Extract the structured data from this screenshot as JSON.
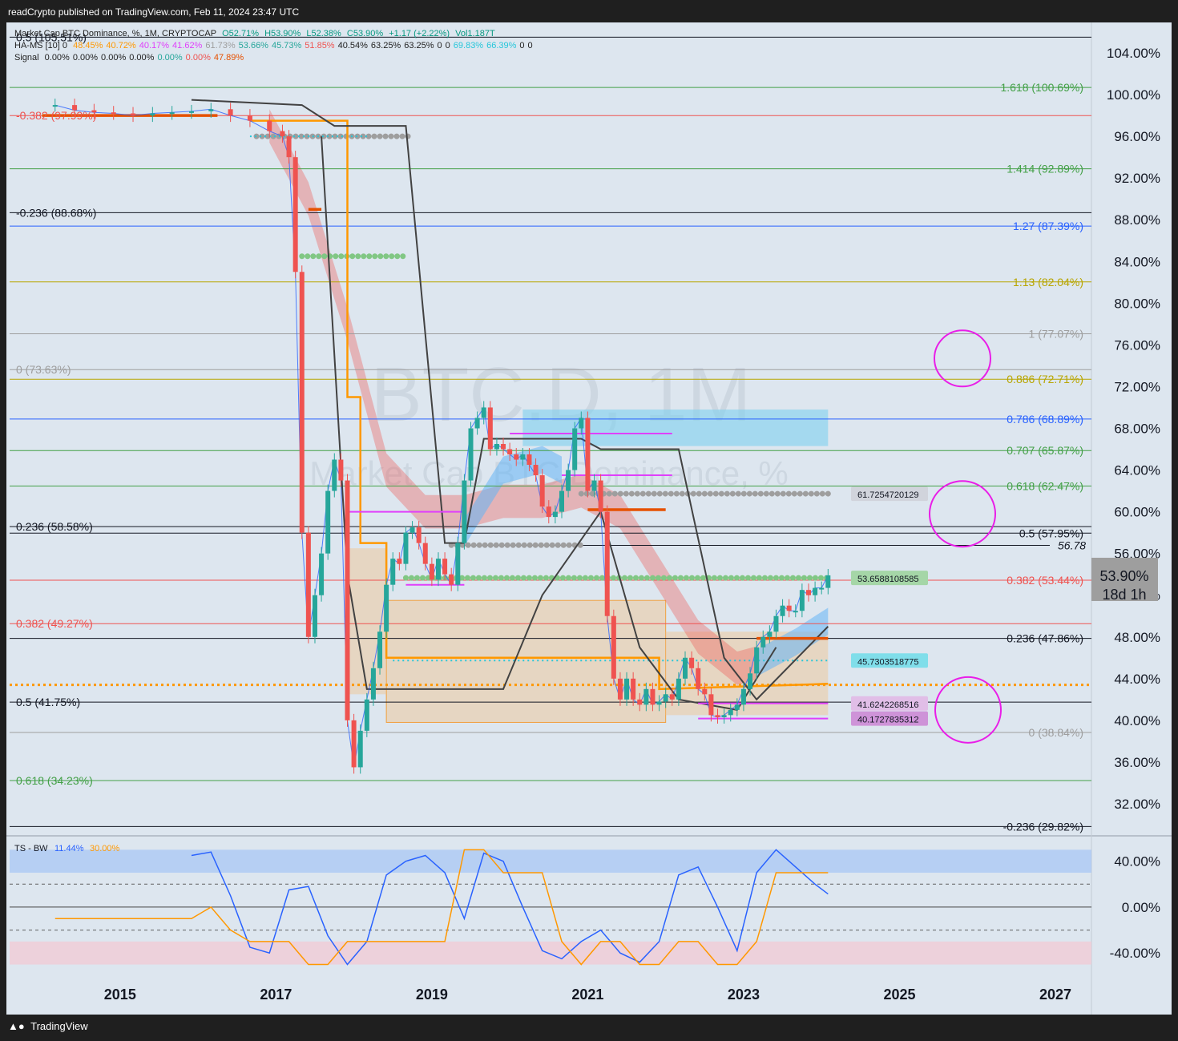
{
  "header": {
    "publisher": "readCrypto published on TradingView.com, Feb 11, 2024 23:47 UTC"
  },
  "footer": {
    "brand": "TradingView"
  },
  "legend": {
    "line1": {
      "name": "Market Cap BTC Dominance, %, 1M, CRYPTOCAP",
      "o": "O52.71%",
      "h": "H53.90%",
      "l": "L52.38%",
      "c": "C53.90%",
      "chg": "+1.17 (+2.22%)",
      "vol": "Vol1.187T"
    },
    "line2": {
      "name": "HA-MS [10] 0",
      "vals": [
        "48.45%",
        "40.72%",
        "40.17%",
        "41.62%",
        "61.73%",
        "53.66%",
        "45.73%",
        "51.85%",
        "40.54%",
        "63.25%",
        "63.25%",
        "0",
        "0",
        "69.83%",
        "66.39%",
        "0",
        "0"
      ]
    },
    "line3": {
      "name": "Signal",
      "vals": [
        "0.00%",
        "0.00%",
        "0.00%",
        "0.00%",
        "0.00%",
        "0.00%",
        "47.89%"
      ]
    }
  },
  "watermark": {
    "symbol": "BTC.D, 1M",
    "name": "Market Cap BTC Dominance, %"
  },
  "colors": {
    "up": "#26a69a",
    "down": "#ef5350",
    "fib_green": "#43a047",
    "fib_blue": "#2962ff",
    "fib_yellow": "#b8a500",
    "magenta": "#e040fb",
    "orange": "#ff9800"
  },
  "chart_data": [
    {
      "type": "candlestick",
      "title": "Market Cap BTC Dominance, %, 1M, CRYPTOCAP",
      "ylim": [
        29,
        106
      ],
      "y_ticks": [
        "104.00%",
        "100.00%",
        "96.00%",
        "92.00%",
        "88.00%",
        "84.00%",
        "80.00%",
        "76.00%",
        "72.00%",
        "68.00%",
        "64.00%",
        "60.00%",
        "56.00%",
        "52.00%",
        "48.00%",
        "44.00%",
        "40.00%",
        "36.00%",
        "32.00%"
      ],
      "x_ticks": [
        "2015",
        "2017",
        "2019",
        "2021",
        "2023",
        "2025",
        "2027"
      ],
      "price_label": {
        "value": "53.90%",
        "countdown": "18d 1h"
      },
      "close_series": {
        "dates": [
          "2014-03",
          "2014-06",
          "2014-09",
          "2014-12",
          "2015-03",
          "2015-06",
          "2015-09",
          "2015-12",
          "2016-03",
          "2016-06",
          "2016-09",
          "2016-12",
          "2017-02",
          "2017-03",
          "2017-04",
          "2017-05",
          "2017-06",
          "2017-07",
          "2017-08",
          "2017-09",
          "2017-10",
          "2017-11",
          "2017-12",
          "2018-01",
          "2018-02",
          "2018-03",
          "2018-04",
          "2018-05",
          "2018-06",
          "2018-07",
          "2018-08",
          "2018-09",
          "2018-10",
          "2018-11",
          "2018-12",
          "2019-01",
          "2019-02",
          "2019-03",
          "2019-04",
          "2019-05",
          "2019-06",
          "2019-07",
          "2019-08",
          "2019-09",
          "2019-10",
          "2019-11",
          "2019-12",
          "2020-01",
          "2020-02",
          "2020-03",
          "2020-04",
          "2020-05",
          "2020-06",
          "2020-07",
          "2020-08",
          "2020-09",
          "2020-10",
          "2020-11",
          "2020-12",
          "2021-01",
          "2021-02",
          "2021-03",
          "2021-04",
          "2021-05",
          "2021-06",
          "2021-07",
          "2021-08",
          "2021-09",
          "2021-10",
          "2021-11",
          "2021-12",
          "2022-01",
          "2022-02",
          "2022-03",
          "2022-04",
          "2022-05",
          "2022-06",
          "2022-07",
          "2022-08",
          "2022-09",
          "2022-10",
          "2022-11",
          "2022-12",
          "2023-01",
          "2023-02",
          "2023-03",
          "2023-04",
          "2023-05",
          "2023-06",
          "2023-07",
          "2023-08",
          "2023-09",
          "2023-10",
          "2023-11",
          "2023-12",
          "2024-01",
          "2024-02"
        ],
        "values": [
          99.0,
          98.5,
          98.3,
          98.2,
          98.0,
          98.2,
          98.3,
          98.4,
          98.6,
          98.0,
          97.5,
          96.5,
          96.0,
          94.0,
          83.0,
          58.0,
          48.0,
          52.0,
          56.0,
          62.0,
          65.0,
          63.0,
          40.0,
          35.5,
          39.0,
          42.0,
          45.0,
          48.5,
          53.0,
          55.5,
          55.0,
          58.0,
          58.5,
          57.0,
          55.0,
          53.5,
          55.5,
          54.0,
          53.0,
          57.0,
          63.0,
          68.0,
          69.0,
          70.0,
          66.0,
          66.5,
          66.0,
          65.5,
          65.0,
          65.5,
          64.5,
          63.5,
          60.5,
          59.5,
          60.0,
          62.0,
          64.0,
          68.0,
          69.0,
          62.0,
          63.0,
          60.0,
          50.0,
          44.0,
          42.0,
          44.0,
          42.0,
          41.5,
          43.0,
          41.5,
          41.8,
          42.5,
          42.0,
          44.0,
          46.0,
          45.0,
          43.0,
          42.5,
          40.5,
          40.3,
          40.5,
          41.0,
          41.5,
          43.0,
          44.5,
          47.0,
          48.0,
          48.5,
          50.0,
          51.0,
          50.5,
          50.5,
          52.5,
          52.0,
          52.7,
          52.7,
          53.9
        ]
      },
      "left_fib_levels": [
        {
          "label": "0.5 (105.51%)",
          "value": 105.51
        },
        {
          "label": "-0.382 (97.99%)",
          "value": 97.99
        },
        {
          "label": "-0.236 (88.68%)",
          "value": 88.68
        },
        {
          "label": "0 (73.63%)",
          "value": 73.63
        },
        {
          "label": "0.236 (58.58%)",
          "value": 58.58
        },
        {
          "label": "0.382 (49.27%)",
          "value": 49.27
        },
        {
          "label": "0.5 (41.75%)",
          "value": 41.75
        },
        {
          "label": "0.618 (34.23%)",
          "value": 34.23
        }
      ],
      "right_fib_levels": [
        {
          "label": "1.618 (100.69%)",
          "value": 100.69
        },
        {
          "label": "1.414 (92.89%)",
          "value": 92.89
        },
        {
          "label": "1.27 (87.39%)",
          "value": 87.39
        },
        {
          "label": "1.13 (82.04%)",
          "value": 82.04
        },
        {
          "label": "1 (77.07%)",
          "value": 77.07
        },
        {
          "label": "0.886 (72.71%)",
          "value": 72.71
        },
        {
          "label": "0.786 (68.89%)",
          "value": 68.89
        },
        {
          "label": "0.707 (65.87%)",
          "value": 65.87
        },
        {
          "label": "0.618 (62.47%)",
          "value": 62.47
        },
        {
          "label": "0.5 (57.95%)",
          "value": 57.95
        },
        {
          "label": "0.382 (53.44%)",
          "value": 53.44
        },
        {
          "label": "0.236 (47.86%)",
          "value": 47.86
        },
        {
          "label": "0 (38.84%)",
          "value": 38.84
        },
        {
          "label": "-0.236 (29.82%)",
          "value": 29.82
        }
      ],
      "level_tags": [
        {
          "label": "61.7254720129",
          "value": 61.73
        },
        {
          "label": "53.6588108585",
          "value": 53.66
        },
        {
          "label": "45.7303518775",
          "value": 45.73
        },
        {
          "label": "41.6242268516",
          "value": 41.62
        },
        {
          "label": "40.1727835312",
          "value": 40.17
        }
      ],
      "extra_labels": [
        {
          "label": "56.78",
          "value": 56.78
        }
      ],
      "highlight_circles_at": [
        74.7,
        59.8,
        41.0
      ]
    },
    {
      "type": "line",
      "title": "TS - BW",
      "legend": [
        {
          "name": "11.44%",
          "color": "#2962ff"
        },
        {
          "name": "30.00%",
          "color": "#ff9800"
        }
      ],
      "ylim": [
        -58,
        60
      ],
      "y_ticks": [
        "40.00%",
        "0.00%",
        "-40.00%"
      ],
      "series": [
        {
          "name": "11.44%",
          "dates": [
            "2015-12",
            "2016-03",
            "2016-06",
            "2016-09",
            "2016-12",
            "2017-03",
            "2017-06",
            "2017-09",
            "2017-12",
            "2018-03",
            "2018-06",
            "2018-09",
            "2018-12",
            "2019-03",
            "2019-06",
            "2019-09",
            "2019-12",
            "2020-03",
            "2020-06",
            "2020-09",
            "2020-12",
            "2021-03",
            "2021-06",
            "2021-09",
            "2021-12",
            "2022-03",
            "2022-06",
            "2022-09",
            "2022-12",
            "2023-03",
            "2023-06",
            "2023-09",
            "2023-12",
            "2024-02"
          ],
          "values": [
            45,
            48,
            10,
            -35,
            -40,
            15,
            18,
            -25,
            -50,
            -30,
            28,
            40,
            45,
            30,
            -10,
            47,
            40,
            0,
            -38,
            -45,
            -30,
            -20,
            -40,
            -48,
            -30,
            28,
            35,
            0,
            -38,
            30,
            50,
            35,
            20,
            11.44
          ]
        },
        {
          "name": "30.00%",
          "dates": [
            "2014-03",
            "2015-12",
            "2016-03",
            "2016-06",
            "2016-09",
            "2017-03",
            "2017-06",
            "2017-09",
            "2017-12",
            "2018-03",
            "2018-06",
            "2018-09",
            "2018-12",
            "2019-03",
            "2019-06",
            "2019-09",
            "2019-12",
            "2020-03",
            "2020-06",
            "2020-09",
            "2020-12",
            "2021-03",
            "2021-06",
            "2021-09",
            "2021-12",
            "2022-03",
            "2022-06",
            "2022-09",
            "2022-12",
            "2023-03",
            "2023-06",
            "2023-09",
            "2023-12",
            "2024-02"
          ],
          "values": [
            -10,
            -10,
            0,
            -20,
            -30,
            -30,
            -50,
            -50,
            -30,
            -30,
            -30,
            -30,
            -30,
            -30,
            50,
            50,
            30,
            30,
            30,
            -30,
            -50,
            -30,
            -30,
            -50,
            -50,
            -30,
            -30,
            -50,
            -50,
            -30,
            30,
            30,
            30,
            30
          ]
        }
      ]
    }
  ]
}
